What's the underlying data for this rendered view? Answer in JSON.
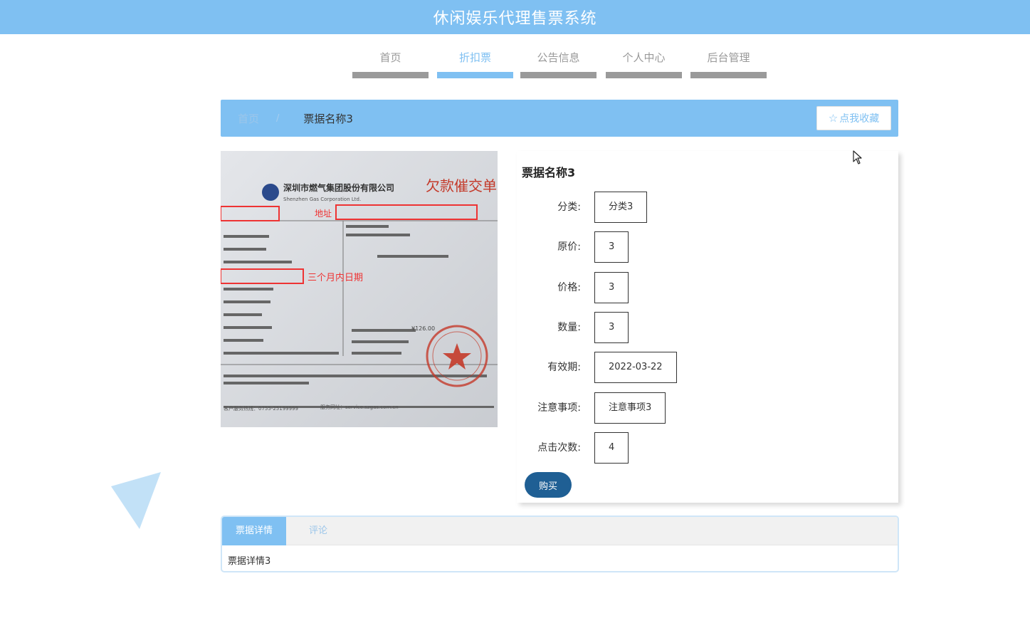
{
  "header": {
    "title": "休闲娱乐代理售票系统"
  },
  "nav": {
    "items": [
      {
        "label": "首页",
        "active": false
      },
      {
        "label": "折扣票",
        "active": true
      },
      {
        "label": "公告信息",
        "active": false
      },
      {
        "label": "个人中心",
        "active": false
      },
      {
        "label": "后台管理",
        "active": false
      }
    ]
  },
  "breadcrumb": {
    "home": "首页",
    "separator": "/",
    "current": "票据名称3",
    "favorite_label": "点我收藏",
    "favorite_icon": "star-icon"
  },
  "product": {
    "name": "票据名称3",
    "fields": [
      {
        "label": "分类:",
        "value": "分类3"
      },
      {
        "label": "原价:",
        "value": "3"
      },
      {
        "label": "价格:",
        "value": "3"
      },
      {
        "label": "数量:",
        "value": "3"
      },
      {
        "label": "有效期:",
        "value": "2022-03-22"
      },
      {
        "label": "注意事项:",
        "value": "注意事项3"
      },
      {
        "label": "点击次数:",
        "value": "4"
      }
    ],
    "buy_label": "购买"
  },
  "photo": {
    "company_cn": "深圳市燃气集团股份有限公司",
    "company_en": "Shenzhen Gas Corporation Ltd.",
    "doc_title": "欠款催交单",
    "annotation_address": "地址",
    "annotation_date": "三个月内日期",
    "amount": "¥126.00",
    "footer_hotline": "客户服务热线：0755-25199999",
    "footer_site": "服务网址：service.szgas.com.cn"
  },
  "tabs": {
    "items": [
      {
        "label": "票据详情",
        "active": true
      },
      {
        "label": "评论",
        "active": false
      }
    ],
    "content": "票据详情3"
  },
  "colors": {
    "primary": "#7fc0f2",
    "buy": "#1f5f94",
    "nav_bar": "#9a9a9a"
  }
}
